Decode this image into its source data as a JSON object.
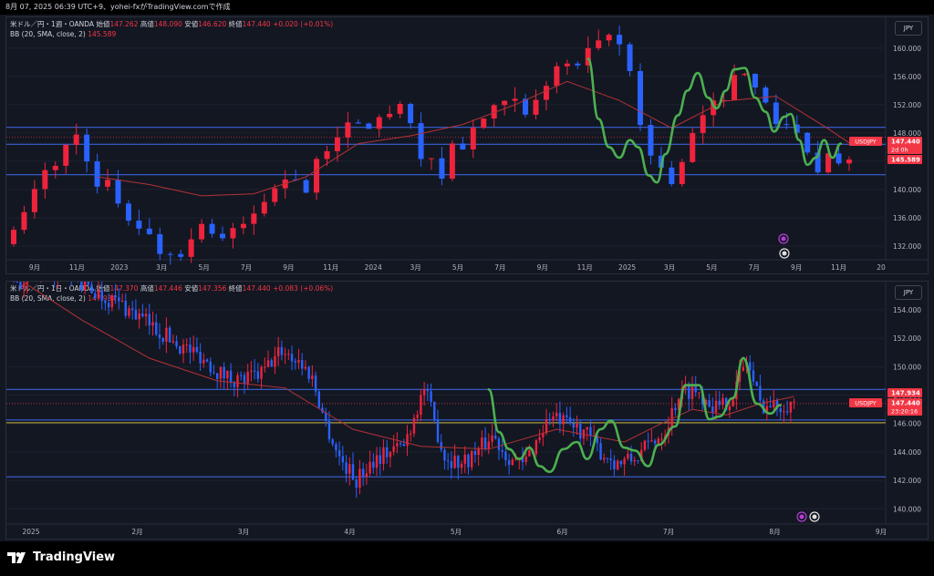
{
  "topbar": {
    "text": "8月 07, 2025 06:39 UTC+9、yohei-fxがTradingView.comで作成"
  },
  "footer": {
    "brand": "TradingView"
  },
  "colors": {
    "bg": "#131722",
    "up": "#ef233c",
    "down": "#2962ff",
    "basis": "#b33236",
    "hline": "#3a63d8",
    "green": "#4caf50",
    "yellow": "#c9b53a",
    "label": "#f23645"
  },
  "panels": [
    {
      "header": {
        "symbol": "米ドル／円・1週・OANDA",
        "open_k": "始値",
        "open_v": "147.262",
        "high_k": "高値",
        "high_v": "148.090",
        "low_k": "安値",
        "low_v": "146.620",
        "close_k": "終値",
        "close_v": "147.440",
        "change": "+0.020 (+0.01%)"
      },
      "indicator": {
        "name": "BB (20, SMA, close, 2)",
        "value": "145.589"
      },
      "currency": "JPY",
      "chart_data": {
        "type": "candlestick",
        "interval": "1W",
        "ylim": [
          129.8,
          163.6
        ],
        "y_ticks": [
          "132.000",
          "136.000",
          "140.000",
          "144.000",
          "148.000",
          "152.000",
          "156.000",
          "160.000"
        ],
        "y_tick_values": [
          132,
          136,
          140,
          144,
          148,
          152,
          156,
          160
        ],
        "x_labels": [
          "9月",
          "11月",
          "2023",
          "3月",
          "5月",
          "7月",
          "9月",
          "11月",
          "2024",
          "3月",
          "5月",
          "7月",
          "9月",
          "11月",
          "2025",
          "3月",
          "5月",
          "7月",
          "9月",
          "11月",
          "20"
        ],
        "path_x": [
          0,
          1.3,
          2.3,
          3.5,
          4.2,
          5.6,
          6.3,
          8.1,
          9.2,
          10.6,
          11.5,
          12.8,
          14.1,
          15.3,
          17.2,
          18,
          18.9,
          20.2,
          21.5,
          22.8,
          24.1,
          25.4,
          26.7,
          28,
          28.6,
          29.5,
          30.5,
          31.3,
          32.4,
          33.4,
          34.6,
          35.9,
          37.2,
          38.5,
          39.7,
          40.8,
          41.6,
          42.5,
          43.4,
          44.3,
          45.2,
          46.1,
          47.1,
          48,
          49.3,
          50.6,
          51.9,
          53.2,
          54.6,
          55.9,
          57.2,
          58.4,
          59.5,
          60.4,
          61.3,
          62.2,
          63.3,
          64.3,
          65.3,
          66.6,
          68,
          69.1,
          70.1,
          70.9,
          71.7,
          72.9,
          73.9,
          74.8,
          75.7,
          76.5,
          77.2,
          78,
          78.7,
          79.3,
          79.9,
          80.3,
          80.6
        ],
        "path_close": [
          133.2,
          137.1,
          140.4,
          143.6,
          144.2,
          147.0,
          148.5,
          139.4,
          140.5,
          136.9,
          136.0,
          133.4,
          131.3,
          131.0,
          132.7,
          136.0,
          134.2,
          132.8,
          133.9,
          136.2,
          138.7,
          140.5,
          143.1,
          139.8,
          141.3,
          145.2,
          147.5,
          148.8,
          148.3,
          148.9,
          149.6,
          150.7,
          151.2,
          146.6,
          144.2,
          141.0,
          146.4,
          145.6,
          147.1,
          148.5,
          150.5,
          150.9,
          151.6,
          151.9,
          149.3,
          154.5,
          157.3,
          157.2,
          158.2,
          160.0,
          161.8,
          159.7,
          154.4,
          146.5,
          143.7,
          143.4,
          140.5,
          144.5,
          148.9,
          150.6,
          153.9,
          155.8,
          157.5,
          156.1,
          151.5,
          150.1,
          149.5,
          147.8,
          146.8,
          143.2,
          141.0,
          144.0,
          145.1,
          143.8,
          144.6,
          147.6,
          147.4
        ],
        "bb_basis_x": [
          8,
          13,
          18,
          23,
          28,
          33,
          38,
          43,
          48,
          53,
          58,
          63,
          68,
          73,
          78,
          80
        ],
        "bb_basis_y": [
          141.8,
          140.7,
          139.1,
          139.4,
          141.8,
          146.5,
          147.6,
          149.2,
          152.0,
          155.3,
          152.6,
          148.7,
          152.5,
          153.2,
          148.6,
          146.6
        ],
        "horizontal_lines": [
          148.8,
          146.4,
          142.1
        ],
        "green_trend_path": [
          [
            55,
            158.5
          ],
          [
            56,
            150
          ],
          [
            57,
            146
          ],
          [
            58,
            144.5
          ],
          [
            59,
            147
          ],
          [
            59.8,
            146
          ],
          [
            60.8,
            142
          ],
          [
            61.6,
            141
          ],
          [
            62.4,
            145
          ],
          [
            63.6,
            150.5
          ],
          [
            64.5,
            154
          ],
          [
            65.5,
            156.5
          ],
          [
            66.5,
            153
          ],
          [
            67.3,
            151.5
          ],
          [
            68.2,
            154
          ],
          [
            69,
            157
          ],
          [
            70,
            157.2
          ],
          [
            71,
            153
          ],
          [
            72,
            151
          ],
          [
            72.8,
            148.2
          ],
          [
            73.8,
            150.3
          ],
          [
            74.4,
            150.7
          ],
          [
            75.2,
            147
          ],
          [
            76,
            143.5
          ],
          [
            76.8,
            144.5
          ],
          [
            77.6,
            147
          ],
          [
            78.4,
            144.5
          ],
          [
            79.2,
            146.5
          ]
        ],
        "price_labels": [
          {
            "symbol": "USDJPY",
            "value": "147.440",
            "countdown": "2d 0h"
          },
          {
            "value": "145.589"
          }
        ]
      }
    },
    {
      "header": {
        "symbol": "米ドル／円・1日・OANDA",
        "open_k": "始値",
        "open_v": "147.370",
        "high_k": "高値",
        "high_v": "147.446",
        "low_k": "安値",
        "low_v": "147.356",
        "close_k": "終値",
        "close_v": "147.440",
        "change": "+0.083 (+0.06%)"
      },
      "indicator": {
        "name": "BB (20, SMA, close, 2)",
        "value": "147.934"
      },
      "currency": "JPY",
      "chart_data": {
        "type": "candlestick",
        "interval": "1D",
        "ylim": [
          138.8,
          155.6
        ],
        "y_ticks": [
          "140.000",
          "142.000",
          "144.000",
          "146.000",
          "148.000",
          "150.000",
          "152.000",
          "154.000"
        ],
        "y_tick_values": [
          140,
          142,
          144,
          146,
          148,
          150,
          152,
          154
        ],
        "x_labels": [
          "2025",
          "2月",
          "3月",
          "4月",
          "5月",
          "6月",
          "7月",
          "8月",
          "9月"
        ],
        "path_x": [
          0,
          8,
          14,
          20,
          26,
          31,
          37,
          43,
          49,
          55,
          61,
          67,
          73,
          79,
          84,
          88,
          92,
          96,
          101,
          106,
          110,
          115,
          121,
          127,
          132,
          137,
          141,
          145,
          150,
          154,
          158,
          163,
          168,
          173,
          178,
          183,
          188,
          192,
          196,
          200,
          204,
          208,
          212,
          216,
          220,
          224,
          227,
          230
        ],
        "path_close": [
          156.0,
          156.5,
          157.0,
          155.8,
          155.0,
          154.5,
          153.5,
          152.5,
          151.5,
          150.8,
          149.5,
          149.0,
          149.5,
          151.2,
          150.4,
          149.2,
          146.0,
          143.6,
          142.0,
          143.5,
          144.0,
          144.5,
          148.5,
          143.7,
          143.2,
          144.1,
          145.2,
          143.9,
          143.0,
          144.8,
          146.5,
          145.9,
          145.5,
          144.0,
          143.2,
          143.5,
          144.7,
          145.6,
          148.0,
          148.5,
          147.8,
          147.0,
          148.1,
          150.5,
          147.4,
          147.2,
          147.4,
          147.4
        ],
        "bb_basis_x": [
          0,
          20,
          40,
          60,
          80,
          100,
          120,
          140,
          160,
          180,
          190,
          200,
          210,
          220,
          230
        ],
        "bb_basis_y": [
          156.4,
          153.3,
          150.6,
          149.0,
          148.5,
          145.6,
          144.4,
          144.2,
          145.6,
          144.7,
          145.9,
          147.0,
          146.6,
          147.4,
          147.9
        ],
        "horizontal_lines": [
          148.4,
          146.25,
          142.25
        ],
        "yellow_line": 146.05,
        "green_trend_path": [
          [
            140,
            148.4
          ],
          [
            143,
            145.4
          ],
          [
            146,
            144.2
          ],
          [
            149,
            143.5
          ],
          [
            152,
            144.3
          ],
          [
            155,
            143.0
          ],
          [
            158,
            142.6
          ],
          [
            162,
            144.2
          ],
          [
            166,
            144.7
          ],
          [
            169,
            143.5
          ],
          [
            173,
            145.6
          ],
          [
            176,
            146.2
          ],
          [
            180,
            144.3
          ],
          [
            183,
            144.1
          ],
          [
            187,
            143.0
          ],
          [
            190,
            144.5
          ],
          [
            195,
            145.8
          ],
          [
            198,
            148.7
          ],
          [
            202,
            148.7
          ],
          [
            205,
            146.3
          ],
          [
            208,
            146.5
          ],
          [
            212,
            147.8
          ],
          [
            215,
            150.6
          ],
          [
            219,
            147.4
          ],
          [
            223,
            146.7
          ],
          [
            226,
            147.3
          ]
        ],
        "price_labels": [
          {
            "value": "147.934"
          },
          {
            "symbol": "USDJPY",
            "value": "147.440",
            "countdown": "23:20:16"
          }
        ]
      }
    }
  ]
}
